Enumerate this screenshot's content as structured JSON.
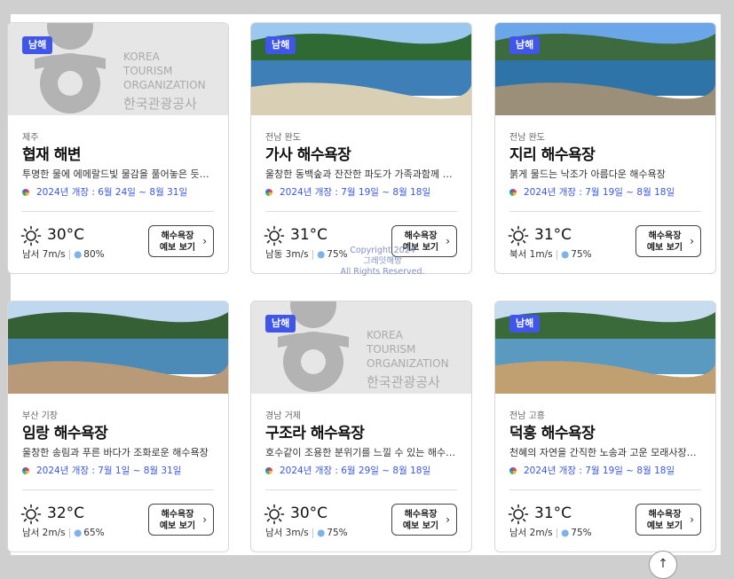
{
  "cards": [
    {
      "badge": "남해",
      "region": "제주",
      "title": "협재 해변",
      "desc": "투명한 물에 에메랄드빛 물감을 풀어놓은 듯…",
      "period": "2024년 개장 : 6월 24일 ~ 8월 31일",
      "temp": "30°C",
      "wind": "남서 7m/s",
      "humidity": "80%",
      "forecast_line1": "해수욕장",
      "forecast_line2": "예보 보기",
      "image": "placeholder-logo"
    },
    {
      "badge": "남해",
      "region": "전남 완도",
      "title": "가사 해수욕장",
      "desc": "울창한 동백숲과 잔잔한 파도가 가족과함께 …",
      "period": "2024년 개장 : 7월 19일 ~ 8월 18일",
      "temp": "31°C",
      "wind": "남동 3m/s",
      "humidity": "75%",
      "forecast_line1": "해수욕장",
      "forecast_line2": "예보 보기",
      "image": "photo"
    },
    {
      "badge": "남해",
      "region": "전남 완도",
      "title": "지리 해수욕장",
      "desc": "붉게 물드는 낙조가 아름다운 해수욕장",
      "period": "2024년 개장 : 7월 19일 ~ 8월 18일",
      "temp": "31°C",
      "wind": "북서 1m/s",
      "humidity": "75%",
      "forecast_line1": "해수욕장",
      "forecast_line2": "예보 보기",
      "image": "photo"
    },
    {
      "badge": "",
      "region": "부산 기장",
      "title": "임랑 해수욕장",
      "desc": "울창한 송림과 푸른 바다가 조화로운 해수욕장",
      "period": "2024년 개장 : 7월 1일 ~ 8월 31일",
      "temp": "32°C",
      "wind": "남서 2m/s",
      "humidity": "65%",
      "forecast_line1": "해수욕장",
      "forecast_line2": "예보 보기",
      "image": "photo"
    },
    {
      "badge": "남해",
      "region": "경남 거제",
      "title": "구조라 해수욕장",
      "desc": "호수같이 조용한 분위기를 느낄 수 있는 해수…",
      "period": "2024년 개장 : 6월 29일 ~ 8월 18일",
      "temp": "30°C",
      "wind": "남서 3m/s",
      "humidity": "75%",
      "forecast_line1": "해수욕장",
      "forecast_line2": "예보 보기",
      "image": "placeholder-logo"
    },
    {
      "badge": "남해",
      "region": "전남 고흥",
      "title": "덕흥 해수욕장",
      "desc": "천혜의 자연을 간직한 노송과 고운 모래사장…",
      "period": "2024년 개장 : 7월 19일 ~ 8월 18일",
      "temp": "31°C",
      "wind": "남서 2m/s",
      "humidity": "75%",
      "forecast_line1": "해수욕장",
      "forecast_line2": "예보 보기",
      "image": "photo"
    }
  ],
  "logo": {
    "line1": "KOREA",
    "line2": "TOURISM",
    "line3": "ORGANIZATION",
    "line4": "한국관광공사"
  },
  "copyright": {
    "line1": "Copyright 2024",
    "line2": "그레잇해방",
    "line3": "All Rights Reserved."
  },
  "scroll_top_icon": "arrow-up-icon",
  "colors": {
    "badge": "#3f56e8",
    "period": "#3a58d8",
    "accent": "#3f56e8"
  }
}
